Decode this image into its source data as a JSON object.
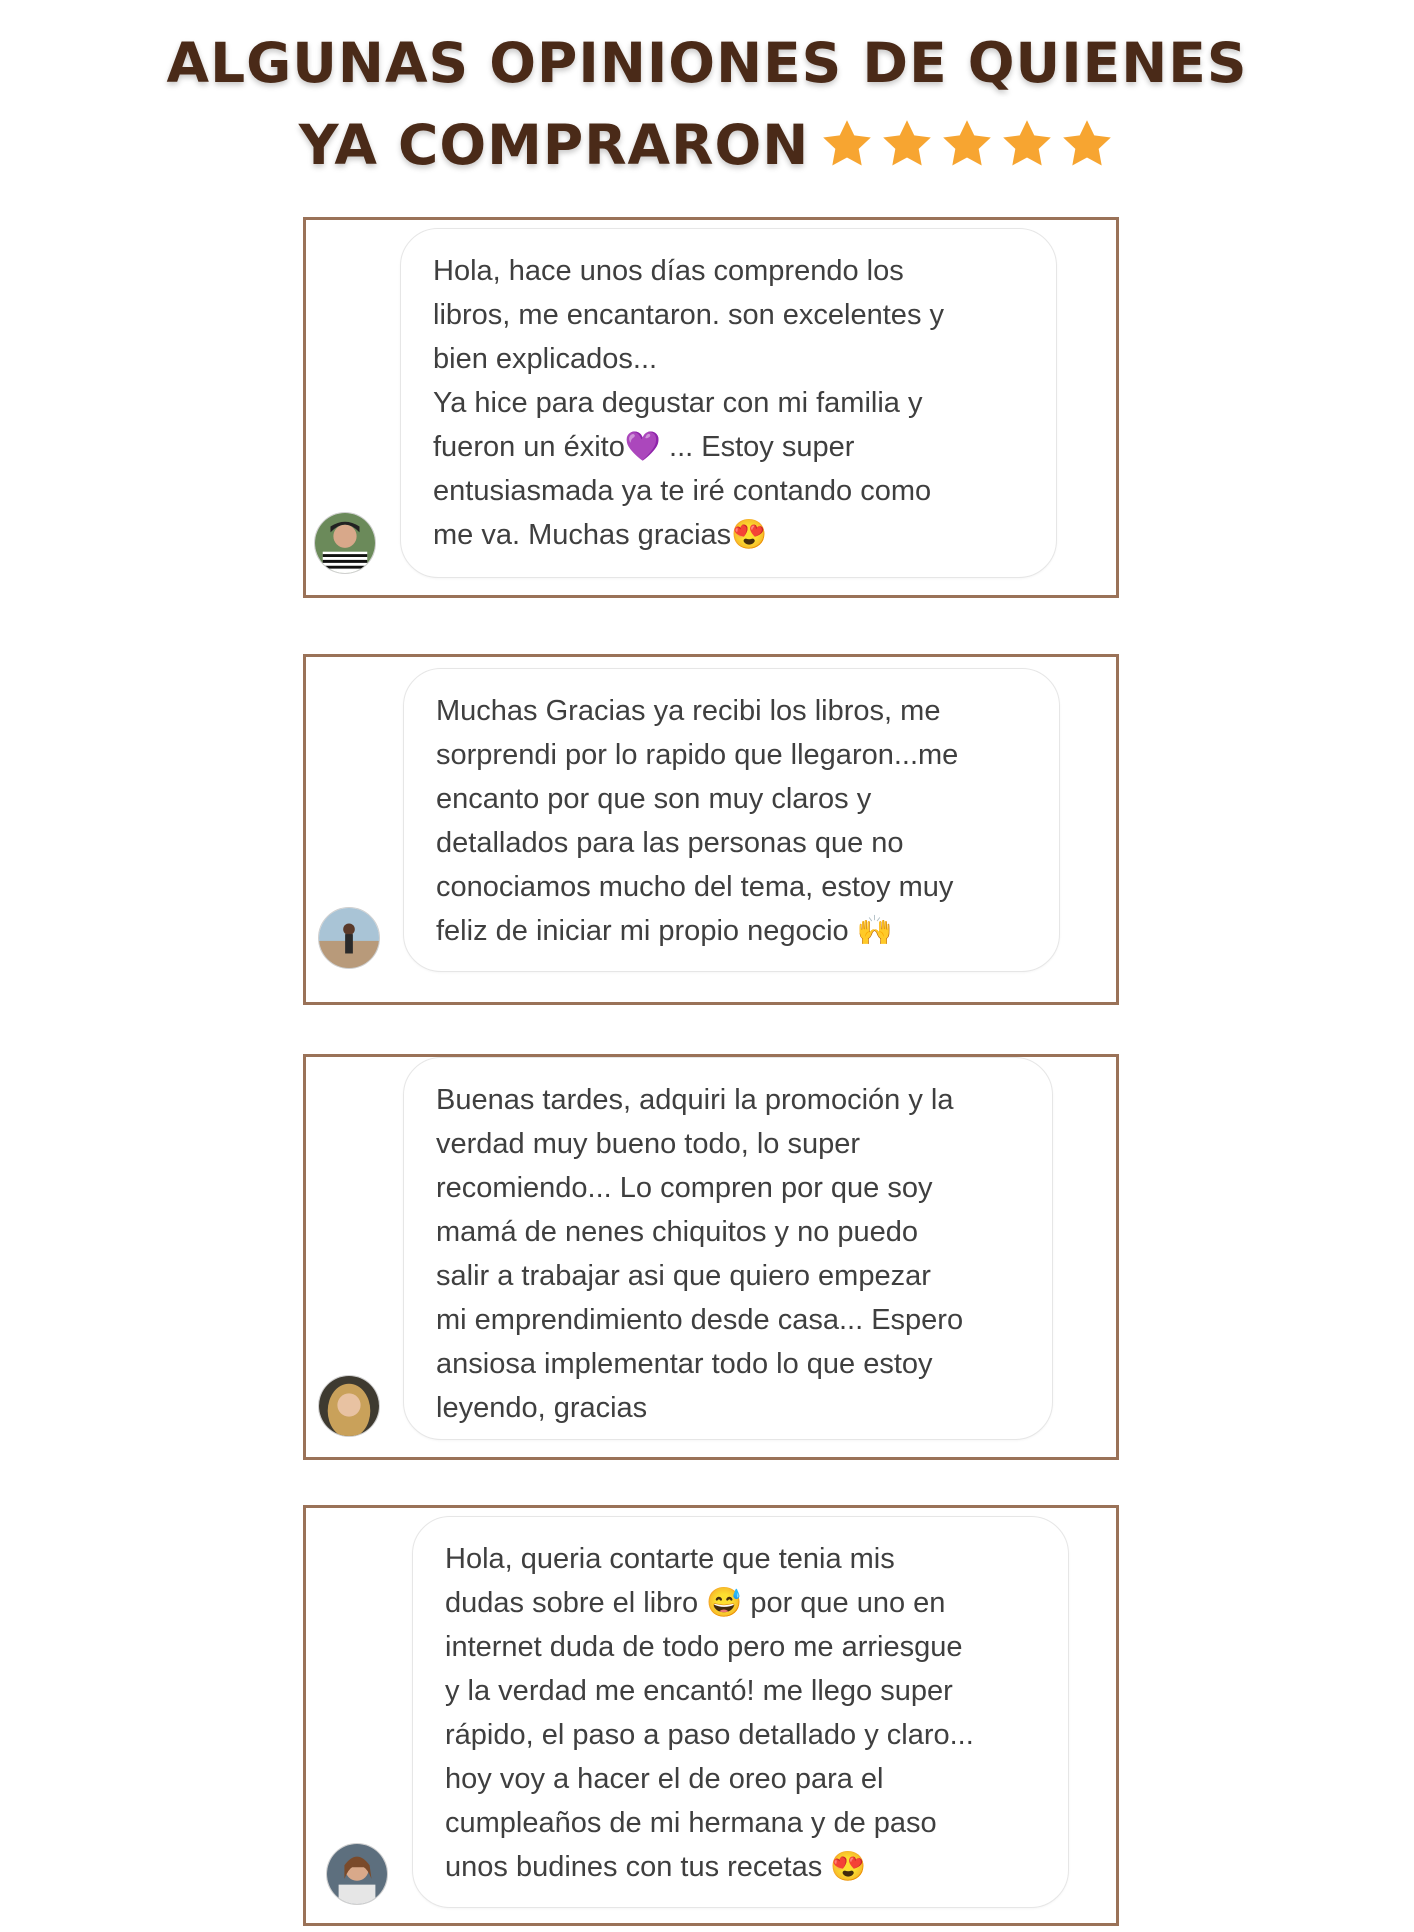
{
  "header": {
    "title_line1": "ALGUNAS OPINIONES DE QUIENES",
    "title_line2": "YA COMPRARON",
    "rating_stars": 5,
    "star_color": "#f7a531",
    "title_color": "#4a2a18"
  },
  "testimonials": [
    {
      "text": "Hola, hace unos días comprendo los\nlibros, me encantaron. son excelentes y\nbien explicados...\nYa hice para degustar con mi familia y\nfueron un éxito💜 ... Estoy super\nentusiasmada ya te iré contando como\nme va. Muchas gracias😍",
      "avatar_icon": "user-avatar-photo"
    },
    {
      "text": "Muchas Gracias ya recibi los libros, me\nsorprendi por lo rapido que llegaron...me\nencanto por que son muy claros y\ndetallados para las personas que no\nconociamos mucho del tema, estoy muy\nfeliz de iniciar mi propio negocio 🙌",
      "avatar_icon": "user-avatar-photo"
    },
    {
      "text": "Buenas tardes, adquiri la promoción y la\nverdad muy bueno todo, lo super\nrecomiendo... Lo compren por que soy\nmamá de nenes chiquitos y no puedo\nsalir a trabajar asi que quiero empezar\nmi emprendimiento desde casa... Espero\nansiosa implementar todo lo que estoy\nleyendo, gracias",
      "avatar_icon": "user-avatar-photo"
    },
    {
      "text": "Hola, queria contarte que tenia mis\ndudas sobre el libro 😅 por que uno en\ninternet duda de todo pero me arriesgue\ny la verdad me encantó! me llego super\nrápido, el paso a paso detallado y claro...\nhoy voy a hacer el de oreo para el\ncumpleaños de mi hermana y de paso\nunos budines con tus recetas 😍",
      "avatar_icon": "user-avatar-photo"
    }
  ]
}
